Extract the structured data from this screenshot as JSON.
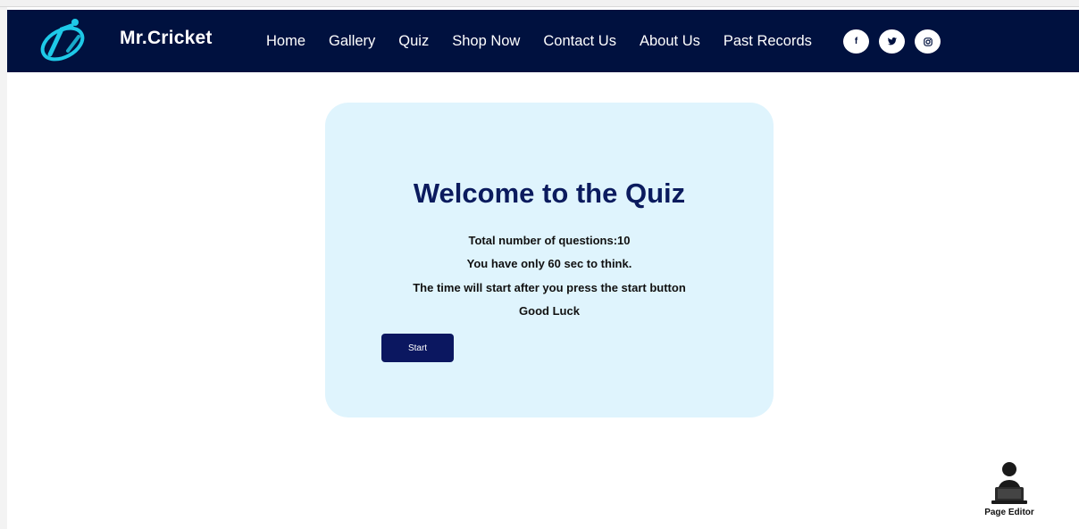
{
  "navbar": {
    "brand": "Mr.Cricket",
    "links": [
      {
        "label": "Home"
      },
      {
        "label": "Gallery"
      },
      {
        "label": "Quiz"
      },
      {
        "label": "Shop Now"
      },
      {
        "label": "Contact Us"
      },
      {
        "label": "About Us"
      },
      {
        "label": "Past Records"
      }
    ],
    "socials": [
      {
        "icon": "facebook-icon",
        "glyph": "f"
      },
      {
        "icon": "twitter-icon",
        "glyph": "🐦"
      },
      {
        "icon": "instagram-icon",
        "glyph": "◎"
      }
    ],
    "background_color": "#00113f",
    "logo_color": "#1ec9e8"
  },
  "quiz": {
    "title": "Welcome to the Quiz",
    "lines": [
      "Total number of questions:10",
      "You have only 60 sec to think.",
      "The time will start after you press the start button",
      "Good Luck"
    ],
    "start_label": "Start",
    "card_color": "#dff4fd",
    "title_color": "#0b1b5e",
    "button_color": "#0b1760"
  },
  "page_editor": {
    "label": "Page Editor",
    "icon": "person-laptop-icon"
  }
}
